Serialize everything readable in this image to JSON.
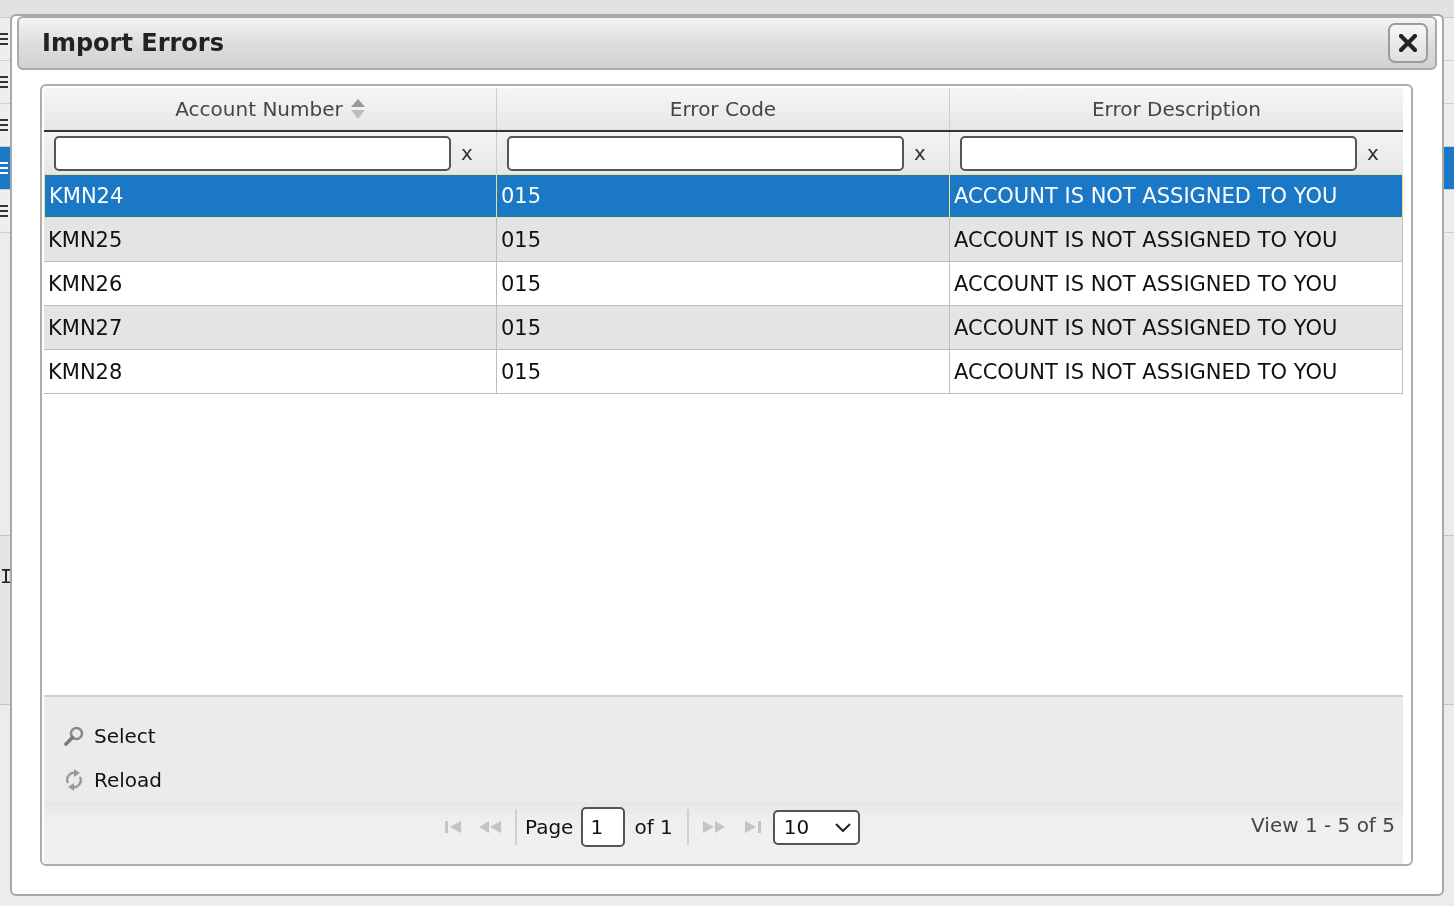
{
  "background": {
    "rows": [
      {
        "selected": false
      },
      {
        "selected": false
      },
      {
        "selected": false
      },
      {
        "selected": true
      },
      {
        "selected": false
      }
    ],
    "text": "I"
  },
  "dialog": {
    "title": "Import Errors"
  },
  "grid": {
    "columns": [
      {
        "label": "Account Number",
        "sortable": true,
        "filter_clear": "x"
      },
      {
        "label": "Error Code",
        "sortable": false,
        "filter_clear": "x"
      },
      {
        "label": "Error Description",
        "sortable": false,
        "filter_clear": "x"
      }
    ],
    "rows": [
      {
        "cells": [
          "KMN24",
          "015",
          "ACCOUNT IS NOT ASSIGNED TO YOU"
        ],
        "selected": true
      },
      {
        "cells": [
          "KMN25",
          "015",
          "ACCOUNT IS NOT ASSIGNED TO YOU"
        ],
        "selected": false
      },
      {
        "cells": [
          "KMN26",
          "015",
          "ACCOUNT IS NOT ASSIGNED TO YOU"
        ],
        "selected": false
      },
      {
        "cells": [
          "KMN27",
          "015",
          "ACCOUNT IS NOT ASSIGNED TO YOU"
        ],
        "selected": false
      },
      {
        "cells": [
          "KMN28",
          "015",
          "ACCOUNT IS NOT ASSIGNED TO YOU"
        ],
        "selected": false
      }
    ]
  },
  "toolbar": [
    {
      "kind": "search",
      "label": "Select"
    },
    {
      "kind": "reload",
      "label": "Reload"
    }
  ],
  "pager": {
    "nav_left": [
      {
        "kind": "first",
        "disabled": true
      },
      {
        "kind": "prev",
        "disabled": true
      }
    ],
    "page_label": "Page",
    "page_value": "1",
    "page_total": "of 1",
    "nav_right": [
      {
        "kind": "next",
        "disabled": true
      },
      {
        "kind": "last",
        "disabled": true
      }
    ],
    "page_size": "10",
    "record_info": "View 1 - 5 of 5"
  }
}
